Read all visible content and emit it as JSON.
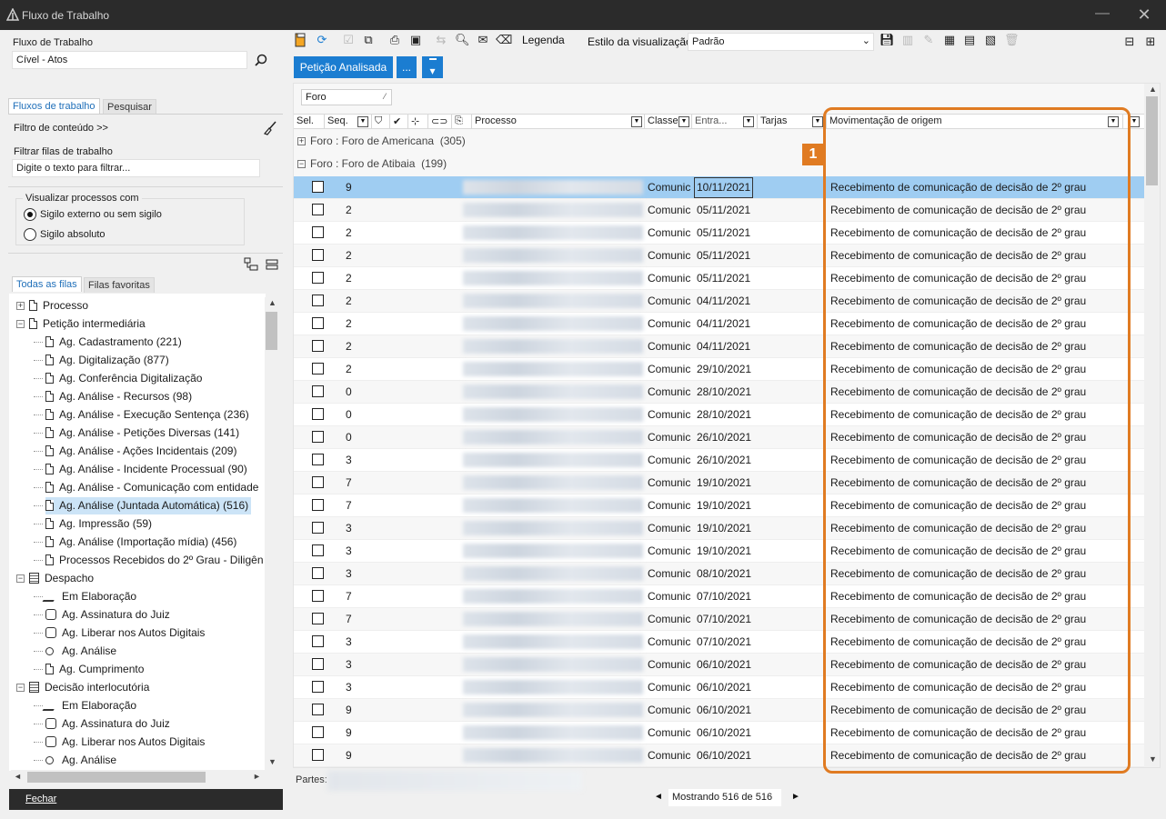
{
  "window": {
    "title": "Fluxo de Trabalho",
    "minimize_glyph": "—",
    "close_glyph": "✕"
  },
  "left": {
    "workflow_label": "Fluxo de Trabalho",
    "workflow_value": "Cível - Atos",
    "tabs": [
      "Fluxos de trabalho",
      "Pesquisar"
    ],
    "content_filter": "Filtro de conteúdo >>",
    "filter_queues_label": "Filtrar filas de trabalho",
    "filter_placeholder": "Digite o texto para filtrar...",
    "visualize_label": "Visualizar processos com",
    "radio_external": "Sigilo externo ou sem sigilo",
    "radio_absolute": "Sigilo absoluto",
    "queue_tabs": [
      "Todas as filas",
      "Filas favoritas"
    ],
    "tree": [
      {
        "label": "Processo",
        "level": 0,
        "icon": "document-icon",
        "expander": "+"
      },
      {
        "label": "Petição intermediária",
        "level": 0,
        "icon": "document-icon",
        "expander": "−"
      },
      {
        "label": "Ag. Cadastramento (221)",
        "level": 1,
        "icon": "document-icon"
      },
      {
        "label": "Ag. Digitalização (877)",
        "level": 1,
        "icon": "document-icon"
      },
      {
        "label": "Ag. Conferência Digitalização",
        "level": 1,
        "icon": "document-icon"
      },
      {
        "label": "Ag. Análise - Recursos (98)",
        "level": 1,
        "icon": "document-icon"
      },
      {
        "label": "Ag. Análise - Execução Sentença (236)",
        "level": 1,
        "icon": "document-icon"
      },
      {
        "label": "Ag. Análise - Petições Diversas (141)",
        "level": 1,
        "icon": "document-icon"
      },
      {
        "label": "Ag. Análise - Ações Incidentais (209)",
        "level": 1,
        "icon": "document-icon"
      },
      {
        "label": "Ag. Análise - Incidente Processual (90)",
        "level": 1,
        "icon": "document-icon"
      },
      {
        "label": "Ag. Análise - Comunicação com entidade",
        "level": 1,
        "icon": "document-icon"
      },
      {
        "label": "Ag. Análise (Juntada Automática) (516)",
        "level": 1,
        "icon": "document-icon",
        "selected": true
      },
      {
        "label": "Ag. Impressão (59)",
        "level": 1,
        "icon": "document-icon"
      },
      {
        "label": "Ag. Análise (Importação mídia) (456)",
        "level": 1,
        "icon": "document-icon"
      },
      {
        "label": "Processos Recebidos do 2º Grau - Diligên",
        "level": 1,
        "icon": "document-icon"
      },
      {
        "label": "Despacho",
        "level": 0,
        "icon": "clipboard-icon",
        "expander": "−"
      },
      {
        "label": "Em Elaboração",
        "level": 1,
        "icon": "pen-icon"
      },
      {
        "label": "Ag. Assinatura do Juiz",
        "level": 1,
        "icon": "seal-icon"
      },
      {
        "label": "Ag. Liberar nos Autos Digitais",
        "level": 1,
        "icon": "seal-icon"
      },
      {
        "label": "Ag. Análise",
        "level": 1,
        "icon": "clock-icon"
      },
      {
        "label": "Ag. Cumprimento",
        "level": 1,
        "icon": "document-icon"
      },
      {
        "label": "Decisão interlocutória",
        "level": 0,
        "icon": "clipboard-icon",
        "expander": "−"
      },
      {
        "label": "Em Elaboração",
        "level": 1,
        "icon": "pen-icon"
      },
      {
        "label": "Ag. Assinatura do Juiz",
        "level": 1,
        "icon": "seal-icon"
      },
      {
        "label": "Ag. Liberar nos Autos Digitais",
        "level": 1,
        "icon": "seal-icon"
      },
      {
        "label": "Ag. Análise",
        "level": 1,
        "icon": "clock-icon"
      }
    ],
    "close_button": "Fechar"
  },
  "toolbar": {
    "legend": "Legenda",
    "view_style_label": "Estilo da visualização",
    "view_style_value": "Padrão",
    "action_button": "Petição Analisada",
    "more_button": "...",
    "colors": {
      "accent": "#1b7dd1",
      "highlight": "#e07b22",
      "selected_row": "#9fcdf2"
    }
  },
  "grid": {
    "group_chip": "Foro",
    "columns": [
      "Sel.",
      "Seq.",
      "Processo",
      "Classe",
      "Entra...",
      "Tarjas",
      "Movimentação de origem"
    ],
    "groups": [
      {
        "label": "Foro : Foro de Americana",
        "count": "(305)",
        "expander": "+"
      },
      {
        "label": "Foro : Foro de Atibaia",
        "count": "(199)",
        "expander": "−"
      }
    ],
    "rows": [
      {
        "seq": "9",
        "classe": "Comunic",
        "data": "10/11/2021",
        "mov": "Recebimento de comunicação de decisão de 2º grau"
      },
      {
        "seq": "2",
        "classe": "Comunic",
        "data": "05/11/2021",
        "mov": "Recebimento de comunicação de decisão de 2º grau"
      },
      {
        "seq": "2",
        "classe": "Comunic",
        "data": "05/11/2021",
        "mov": "Recebimento de comunicação de decisão de 2º grau"
      },
      {
        "seq": "2",
        "classe": "Comunic",
        "data": "05/11/2021",
        "mov": "Recebimento de comunicação de decisão de 2º grau"
      },
      {
        "seq": "2",
        "classe": "Comunic",
        "data": "05/11/2021",
        "mov": "Recebimento de comunicação de decisão de 2º grau"
      },
      {
        "seq": "2",
        "classe": "Comunic",
        "data": "04/11/2021",
        "mov": "Recebimento de comunicação de decisão de 2º grau"
      },
      {
        "seq": "2",
        "classe": "Comunic",
        "data": "04/11/2021",
        "mov": "Recebimento de comunicação de decisão de 2º grau"
      },
      {
        "seq": "2",
        "classe": "Comunic",
        "data": "04/11/2021",
        "mov": "Recebimento de comunicação de decisão de 2º grau"
      },
      {
        "seq": "2",
        "classe": "Comunic",
        "data": "29/10/2021",
        "mov": "Recebimento de comunicação de decisão de 2º grau"
      },
      {
        "seq": "0",
        "classe": "Comunic",
        "data": "28/10/2021",
        "mov": "Recebimento de comunicação de decisão de 2º grau"
      },
      {
        "seq": "0",
        "classe": "Comunic",
        "data": "28/10/2021",
        "mov": "Recebimento de comunicação de decisão de 2º grau"
      },
      {
        "seq": "0",
        "classe": "Comunic",
        "data": "26/10/2021",
        "mov": "Recebimento de comunicação de decisão de 2º grau"
      },
      {
        "seq": "3",
        "classe": "Comunic",
        "data": "26/10/2021",
        "mov": "Recebimento de comunicação de decisão de 2º grau"
      },
      {
        "seq": "7",
        "classe": "Comunic",
        "data": "19/10/2021",
        "mov": "Recebimento de comunicação de decisão de 2º grau"
      },
      {
        "seq": "7",
        "classe": "Comunic",
        "data": "19/10/2021",
        "mov": "Recebimento de comunicação de decisão de 2º grau"
      },
      {
        "seq": "3",
        "classe": "Comunic",
        "data": "19/10/2021",
        "mov": "Recebimento de comunicação de decisão de 2º grau"
      },
      {
        "seq": "3",
        "classe": "Comunic",
        "data": "19/10/2021",
        "mov": "Recebimento de comunicação de decisão de 2º grau"
      },
      {
        "seq": "3",
        "classe": "Comunic",
        "data": "08/10/2021",
        "mov": "Recebimento de comunicação de decisão de 2º grau"
      },
      {
        "seq": "7",
        "classe": "Comunic",
        "data": "07/10/2021",
        "mov": "Recebimento de comunicação de decisão de 2º grau"
      },
      {
        "seq": "7",
        "classe": "Comunic",
        "data": "07/10/2021",
        "mov": "Recebimento de comunicação de decisão de 2º grau"
      },
      {
        "seq": "3",
        "classe": "Comunic",
        "data": "07/10/2021",
        "mov": "Recebimento de comunicação de decisão de 2º grau"
      },
      {
        "seq": "3",
        "classe": "Comunic",
        "data": "06/10/2021",
        "mov": "Recebimento de comunicação de decisão de 2º grau"
      },
      {
        "seq": "3",
        "classe": "Comunic",
        "data": "06/10/2021",
        "mov": "Recebimento de comunicação de decisão de 2º grau"
      },
      {
        "seq": "9",
        "classe": "Comunic",
        "data": "06/10/2021",
        "mov": "Recebimento de comunicação de decisão de 2º grau"
      },
      {
        "seq": "9",
        "classe": "Comunic",
        "data": "06/10/2021",
        "mov": "Recebimento de comunicação de decisão de 2º grau"
      },
      {
        "seq": "9",
        "classe": "Comunic",
        "data": "06/10/2021",
        "mov": "Recebimento de comunicação de decisão de 2º grau"
      }
    ],
    "annotation_badge": "1"
  },
  "footer": {
    "parts_label": "Partes:",
    "pager": "Mostrando 516 de 516",
    "prev_glyph": "◄",
    "next_glyph": "►"
  }
}
